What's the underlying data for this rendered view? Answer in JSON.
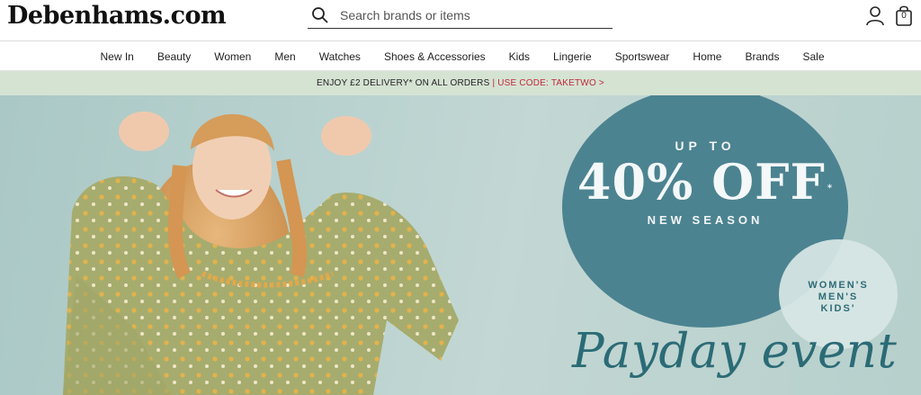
{
  "header": {
    "logo": "Debenhams.com",
    "search": {
      "placeholder": "Search brands or items",
      "icon": "search-icon"
    },
    "account_icon": "account-icon",
    "bag": {
      "icon": "shopping-bag-icon",
      "count": "0"
    }
  },
  "nav": {
    "items": [
      {
        "label": "New In"
      },
      {
        "label": "Beauty"
      },
      {
        "label": "Women"
      },
      {
        "label": "Men"
      },
      {
        "label": "Watches"
      },
      {
        "label": "Shoes & Accessories"
      },
      {
        "label": "Kids"
      },
      {
        "label": "Lingerie"
      },
      {
        "label": "Sportswear"
      },
      {
        "label": "Home"
      },
      {
        "label": "Brands"
      },
      {
        "label": "Sale"
      }
    ]
  },
  "promo": {
    "main": "ENJOY £2 DELIVERY* ON ALL ORDERS",
    "code": "| USE CODE: TAKETWO >"
  },
  "hero": {
    "up_to": "UP TO",
    "discount": "40% OFF",
    "asterisk": "*",
    "new_season": "NEW SEASON",
    "small_line1": "WOMEN'S",
    "small_line2": "MEN'S",
    "small_line3": "KIDS'",
    "headline": "Payday event",
    "colors": {
      "circle": "#4c8391",
      "headline": "#2b6b76",
      "background": "#b9d2cf",
      "promo_code": "#c0283a",
      "promo_bar": "#d5e3d3"
    }
  }
}
